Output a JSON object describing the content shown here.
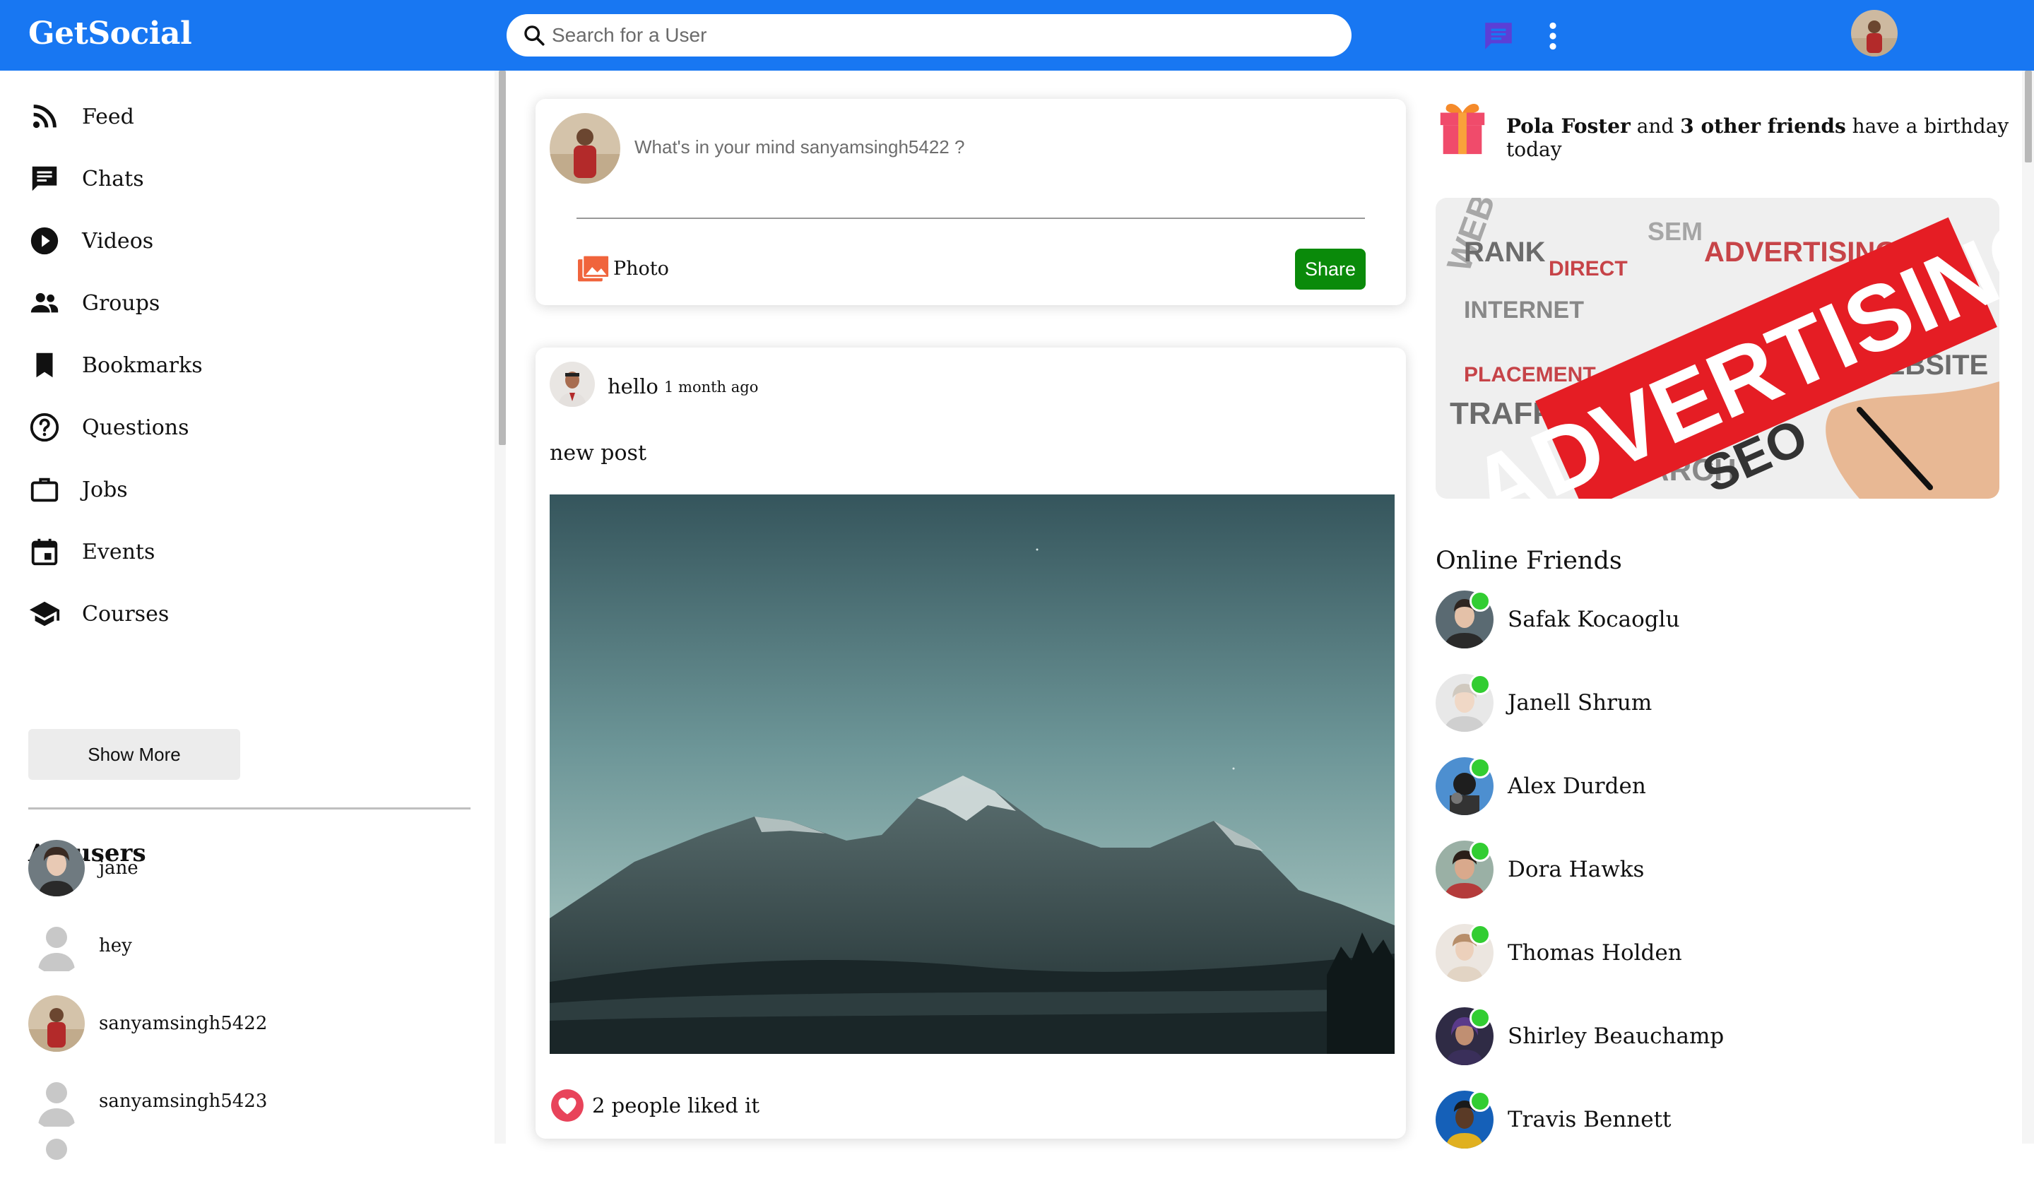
{
  "app": {
    "logo": "GetSocial",
    "accent_color": "#1877f2"
  },
  "search": {
    "placeholder": "Search for a User"
  },
  "header": {
    "chat_icon": "chat-icon",
    "menu_icon": "more-vert-icon"
  },
  "sidebar": {
    "items": [
      {
        "label": "Feed",
        "icon": "rss-icon"
      },
      {
        "label": "Chats",
        "icon": "chat-icon"
      },
      {
        "label": "Videos",
        "icon": "play-circle-icon"
      },
      {
        "label": "Groups",
        "icon": "group-icon"
      },
      {
        "label": "Bookmarks",
        "icon": "bookmark-icon"
      },
      {
        "label": "Questions",
        "icon": "help-circle-icon"
      },
      {
        "label": "Jobs",
        "icon": "briefcase-icon"
      },
      {
        "label": "Events",
        "icon": "calendar-icon"
      },
      {
        "label": "Courses",
        "icon": "school-icon"
      }
    ],
    "show_more": "Show More",
    "all_users_title": "All users",
    "users": [
      {
        "name": "jane"
      },
      {
        "name": "hey"
      },
      {
        "name": "sanyamsingh5422"
      },
      {
        "name": "sanyamsingh5423"
      }
    ]
  },
  "share": {
    "placeholder": "What's in your mind sanyamsingh5422 ?",
    "photo_label": "Photo",
    "share_button": "Share"
  },
  "post": {
    "username": "hello",
    "time": "1 month ago",
    "text": "new post",
    "likes": "2 people liked it"
  },
  "rightbar": {
    "birthday": {
      "name": "Pola Foster",
      "connector": " and ",
      "others": "3 other friends",
      "suffix": " have a birthday today"
    },
    "online_title": "Online Friends",
    "friends": [
      {
        "name": "Safak Kocaoglu"
      },
      {
        "name": "Janell Shrum"
      },
      {
        "name": "Alex Durden"
      },
      {
        "name": "Dora Hawks"
      },
      {
        "name": "Thomas Holden"
      },
      {
        "name": "Shirley Beauchamp"
      },
      {
        "name": "Travis Bennett"
      }
    ],
    "online_color": "#32cd32"
  }
}
